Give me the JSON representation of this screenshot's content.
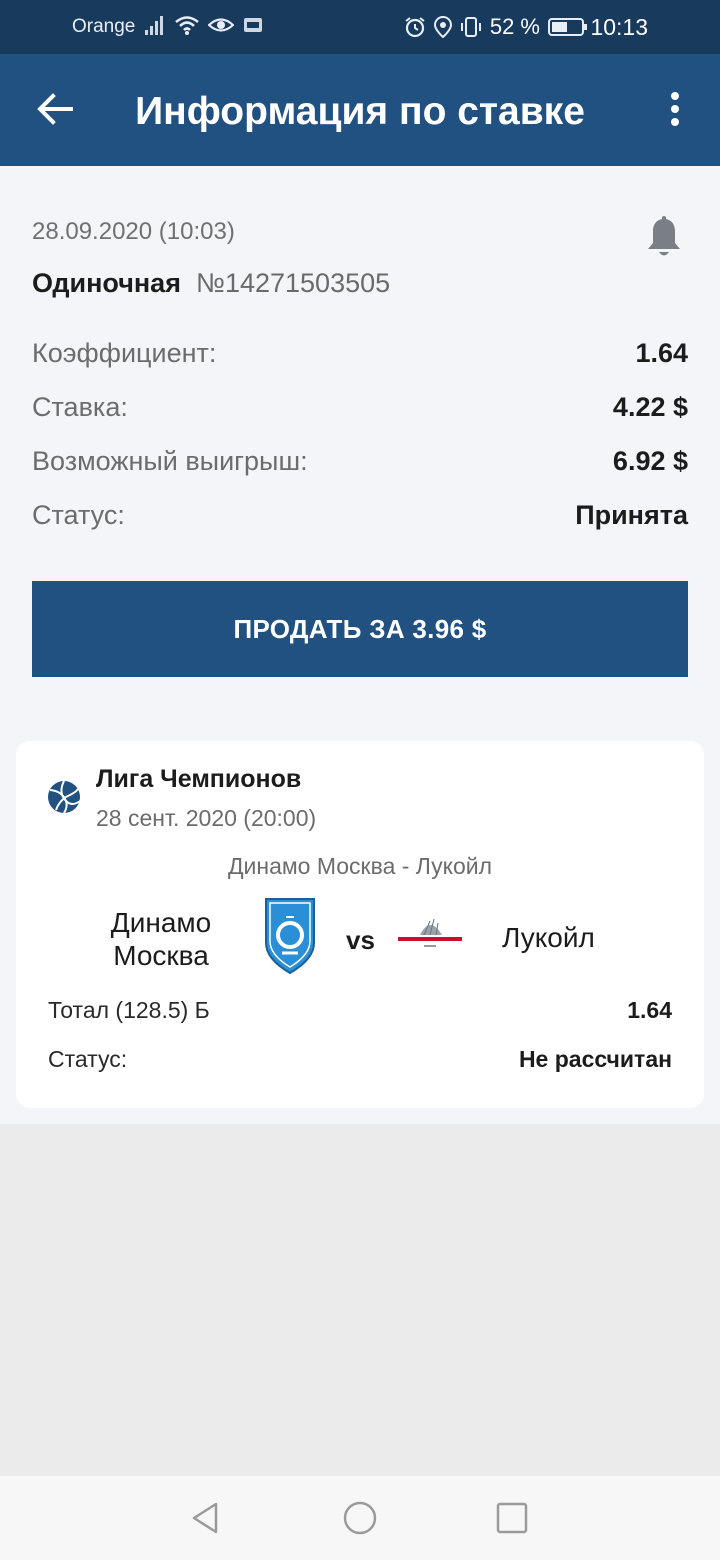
{
  "status_bar": {
    "carrier": "Orange",
    "battery": "52 %",
    "time": "10:13"
  },
  "app_bar": {
    "title": "Информация по ставке"
  },
  "bet": {
    "date": "28.09.2020 (10:03)",
    "type": "Одиночная",
    "number": "№14271503505",
    "rows": [
      {
        "label": "Коэффициент:",
        "value": "1.64"
      },
      {
        "label": "Ставка:",
        "value": "4.22 $"
      },
      {
        "label": "Возможный выигрыш:",
        "value": "6.92 $"
      },
      {
        "label": "Статус:",
        "value": "Принята"
      }
    ],
    "sell_button": "ПРОДАТЬ ЗА 3.96 $"
  },
  "event": {
    "league": "Лига Чемпионов",
    "date": "28 сент. 2020 (20:00)",
    "match": "Динамо Москва - Лукойл",
    "team1": "Динамо Москва",
    "vs": "vs",
    "team2": "Лукойл",
    "pick": "Тотал (128.5) Б",
    "pick_odds": "1.64",
    "status_label": "Статус:",
    "status_value": "Не рассчитан"
  },
  "colors": {
    "status_bar": "#183a5d",
    "app_bar": "#215180",
    "accent": "#215180",
    "background": "#f3f5f9"
  }
}
